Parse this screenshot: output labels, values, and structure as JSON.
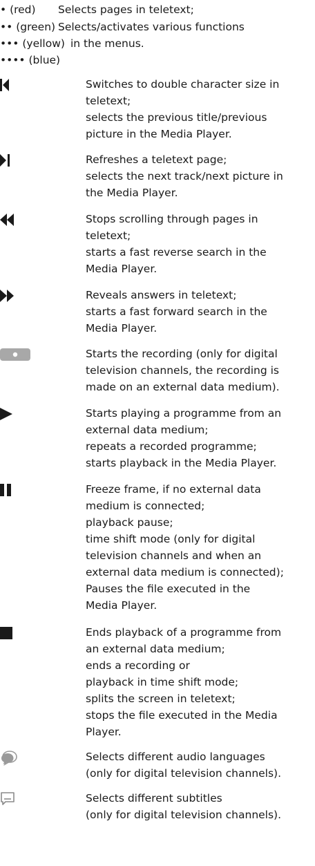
{
  "color_buttons": {
    "red_label": "• (red)",
    "red_desc": "Selects pages in teletext;",
    "green_label": "•• (green)",
    "green_desc": "Selects/activates various functions",
    "yellow_label": "••• (yellow)",
    "yellow_desc": "in the menus.",
    "blue_label": "•••• (blue)"
  },
  "entries": [
    {
      "icon": "skip-back-icon",
      "lines": [
        "Switches to double character size in",
        "teletext;",
        "selects the previous title/previous",
        "picture in the Media Player."
      ]
    },
    {
      "icon": "skip-forward-icon",
      "lines": [
        "Refreshes a teletext page;",
        "selects the next track/next picture in",
        "the Media Player."
      ]
    },
    {
      "icon": "rewind-icon",
      "lines": [
        "Stops scrolling through pages in",
        "teletext;",
        "starts a fast reverse search in the",
        "Media Player."
      ]
    },
    {
      "icon": "fast-forward-icon",
      "lines": [
        "Reveals answers in teletext;",
        "starts a fast forward search in the",
        "Media Player."
      ]
    },
    {
      "icon": "record-icon",
      "lines": [
        "Starts the recording (only for digital",
        "television channels, the recording is",
        "made on an external data medium)."
      ]
    },
    {
      "icon": "play-icon",
      "lines": [
        "Starts playing a programme from an",
        "external data medium;",
        "repeats a recorded programme;",
        "starts playback in the Media Player."
      ]
    },
    {
      "icon": "pause-icon",
      "lines": [
        "Freeze frame, if no external data",
        "medium is connected;",
        "playback pause;",
        "time shift mode (only for digital",
        "television channels and when an",
        "external data medium is connected);",
        "Pauses the file executed in the",
        "Media Player."
      ]
    },
    {
      "icon": "stop-icon",
      "lines": [
        "Ends playback of a programme from",
        "an external data medium;",
        "ends a recording or",
        "playback in time shift mode;",
        "splits the screen in teletext;",
        "stops the file executed in the Media",
        "Player."
      ]
    },
    {
      "icon": "audio-language-icon",
      "lines": [
        "Selects different audio languages",
        "(only for digital television channels)."
      ]
    },
    {
      "icon": "subtitles-icon",
      "lines": [
        "Selects different subtitles",
        "(only for digital television channels)."
      ]
    }
  ]
}
